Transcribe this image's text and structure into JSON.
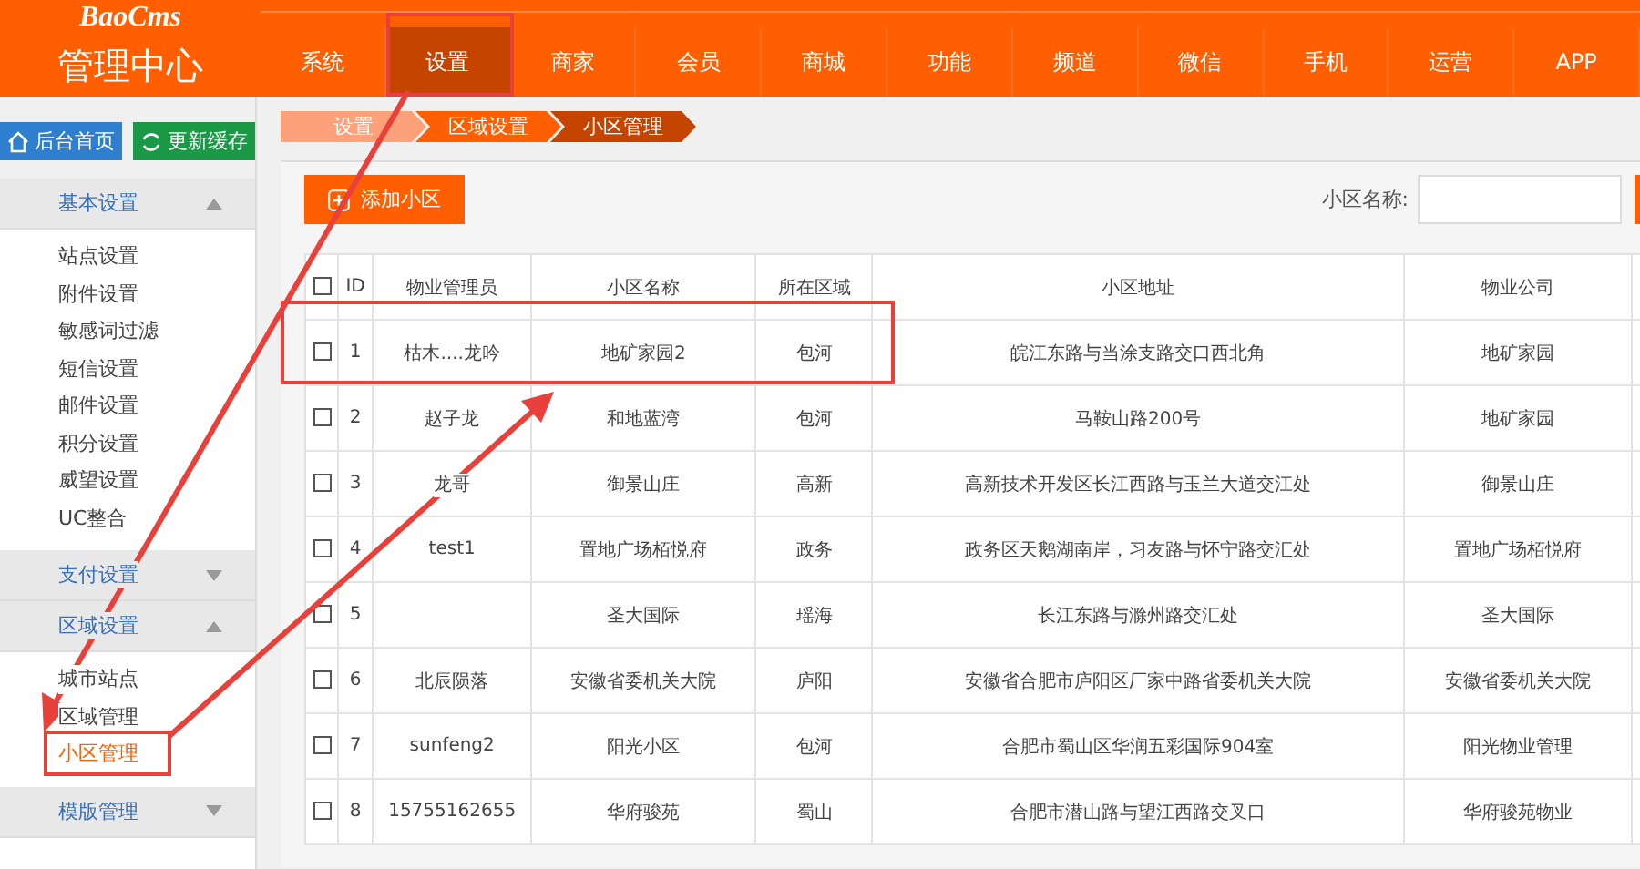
{
  "logo": {
    "brand": "BaoCms",
    "title": "管理中心"
  },
  "nav": [
    {
      "label": "系统",
      "selected": false
    },
    {
      "label": "设置",
      "selected": true
    },
    {
      "label": "商家",
      "selected": false
    },
    {
      "label": "会员",
      "selected": false
    },
    {
      "label": "商城",
      "selected": false
    },
    {
      "label": "功能",
      "selected": false
    },
    {
      "label": "频道",
      "selected": false
    },
    {
      "label": "微信",
      "selected": false
    },
    {
      "label": "手机",
      "selected": false
    },
    {
      "label": "运营",
      "selected": false
    },
    {
      "label": "APP",
      "selected": false
    }
  ],
  "sidebar": {
    "home_button": "后台首页",
    "refresh_button": "更新缓存",
    "groups": [
      {
        "title": "基本设置",
        "expanded": true,
        "items": [
          {
            "label": "站点设置",
            "selected": false
          },
          {
            "label": "附件设置",
            "selected": false
          },
          {
            "label": "敏感词过滤",
            "selected": false
          },
          {
            "label": "短信设置",
            "selected": false
          },
          {
            "label": "邮件设置",
            "selected": false
          },
          {
            "label": "积分设置",
            "selected": false
          },
          {
            "label": "威望设置",
            "selected": false
          },
          {
            "label": "UC整合",
            "selected": false
          }
        ]
      },
      {
        "title": "支付设置",
        "expanded": false
      },
      {
        "title": "区域设置",
        "expanded": true,
        "items": [
          {
            "label": "城市站点",
            "selected": false
          },
          {
            "label": "区域管理",
            "selected": false
          },
          {
            "label": "小区管理",
            "selected": true
          }
        ]
      },
      {
        "title": "模版管理",
        "expanded": false
      }
    ]
  },
  "breadcrumb": [
    "设置",
    "区域设置",
    "小区管理"
  ],
  "toolbar": {
    "add_button": "添加小区",
    "search_label": "小区名称:"
  },
  "table": {
    "select_all_checked": false,
    "columns": [
      "ID",
      "物业管理员",
      "小区名称",
      "所在区域",
      "小区地址",
      "物业公司"
    ],
    "rows": [
      {
        "checked": false,
        "cells": [
          "1",
          "枯木....龙吟",
          "地矿家园2",
          "包河",
          "皖江东路与当涂支路交口西北角",
          "地矿家园"
        ]
      },
      {
        "checked": false,
        "cells": [
          "2",
          "赵子龙",
          "和地蓝湾",
          "包河",
          "马鞍山路200号",
          "地矿家园"
        ]
      },
      {
        "checked": false,
        "cells": [
          "3",
          "龙哥",
          "御景山庄",
          "高新",
          "高新技术开发区长江西路与玉兰大道交江处",
          "御景山庄"
        ]
      },
      {
        "checked": false,
        "cells": [
          "4",
          "test1",
          "置地广场栢悦府",
          "政务",
          "政务区天鹅湖南岸，习友路与怀宁路交汇处",
          "置地广场栢悦府"
        ]
      },
      {
        "checked": false,
        "cells": [
          "5",
          "",
          "圣大国际",
          "瑶海",
          "长江东路与滁州路交汇处",
          "圣大国际"
        ]
      },
      {
        "checked": false,
        "cells": [
          "6",
          "北辰陨落",
          "安徽省委机关大院",
          "庐阳",
          "安徽省合肥市庐阳区厂家中路省委机关大院",
          "安徽省委机关大院"
        ]
      },
      {
        "checked": false,
        "cells": [
          "7",
          "sunfeng2",
          "阳光小区",
          "包河",
          "合肥市蜀山区华润五彩国际904室",
          "阳光物业管理"
        ]
      },
      {
        "checked": false,
        "cells": [
          "8",
          "15755162655",
          "华府骏苑",
          "蜀山",
          "合肥市潜山路与望江西路交叉口",
          "华府骏苑物业"
        ]
      }
    ]
  }
}
